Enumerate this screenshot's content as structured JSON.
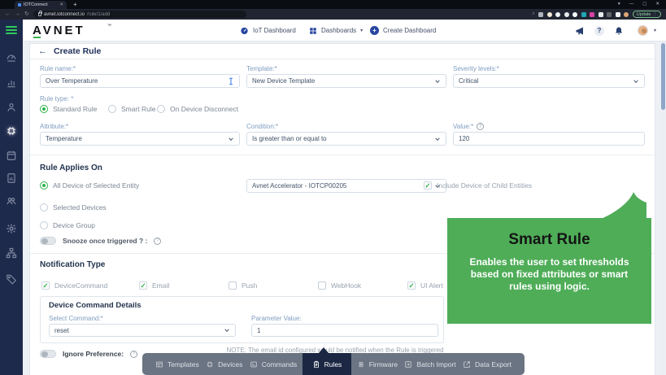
{
  "browser": {
    "tab_title": "IOTConnect",
    "url_domain": "avnet.iotconnect.io",
    "url_path": "/rule/1/add",
    "update_label": "Update"
  },
  "icons": {
    "back": "←",
    "forward": "→",
    "reload": "↻",
    "close": "✕",
    "minimize": "—",
    "maximize": "▢",
    "plus": "+",
    "caret_down": "▾",
    "help": "?",
    "info": "?",
    "kebab": "⋮",
    "tm": "®"
  },
  "header": {
    "logo_text": "AVNET",
    "nav": [
      {
        "label": "IoT Dashboard"
      },
      {
        "label": "Dashboards"
      },
      {
        "label": "Create Dashboard"
      }
    ]
  },
  "page": {
    "title": "Create Rule"
  },
  "form": {
    "rule_name": {
      "label": "Rule name:*",
      "value": "Over Temperature"
    },
    "template": {
      "label": "Template:*",
      "value": "New Device Template"
    },
    "severity": {
      "label": "Severity levels:*",
      "value": "Critical"
    },
    "rule_type": {
      "label": "Rule type: *",
      "options": [
        {
          "label": "Standard Rule",
          "selected": true
        },
        {
          "label": "Smart Rule",
          "selected": false
        },
        {
          "label": "On Device Disconnect",
          "selected": false
        }
      ]
    },
    "attribute": {
      "label": "Attribute:*",
      "value": "Temperature"
    },
    "condition": {
      "label": "Condition:*",
      "value": "Is greater than or equal to"
    },
    "value": {
      "label": "Value:*",
      "value": "120"
    },
    "rule_applies_on": {
      "heading": "Rule Applies On",
      "options": [
        {
          "label": "All Device of Selected Entity",
          "selected": true
        },
        {
          "label": "Selected Devices",
          "selected": false
        },
        {
          "label": "Device Group",
          "selected": false
        }
      ],
      "entity": {
        "value": "Avnet Accelerator - IOTCP00205"
      },
      "include_children": {
        "label": "Include Device of Child Entities",
        "checked": true
      },
      "snooze": {
        "label": "Snooze once triggered ? :",
        "on": false
      }
    },
    "notification": {
      "heading": "Notification Type",
      "options": [
        {
          "label": "DeviceCommand",
          "checked": true
        },
        {
          "label": "Email",
          "checked": true
        },
        {
          "label": "Push",
          "checked": false
        },
        {
          "label": "WebHook",
          "checked": false
        },
        {
          "label": "UI Alert",
          "checked": true
        }
      ]
    },
    "device_command": {
      "heading": "Device Command Details",
      "select_command": {
        "label": "Select Command:*",
        "value": "reset"
      },
      "parameter": {
        "label": "Parameter Value:",
        "value": "1"
      }
    },
    "ignore_preference": {
      "label": "Ignore Preference:",
      "on": false
    },
    "note": "NOTE: The email id configured would be notified when the Rule is triggered"
  },
  "callout": {
    "title": "Smart Rule",
    "body": "Enables the user to set thresholds based on fixed attributes or smart rules using logic.",
    "accent_color": "#4fad58"
  },
  "toolbar": {
    "items": [
      {
        "label": "Templates",
        "active": false
      },
      {
        "label": "Devices",
        "active": false
      },
      {
        "label": "Commands",
        "active": false
      },
      {
        "label": "Rules",
        "active": true
      },
      {
        "label": "Firmware",
        "active": false
      },
      {
        "label": "Batch Import",
        "active": false
      },
      {
        "label": "Data Export",
        "active": false
      }
    ]
  },
  "colors": {
    "navy": "#1e2a4c",
    "green": "#35b54a",
    "label_blue": "#7f9dc1"
  }
}
